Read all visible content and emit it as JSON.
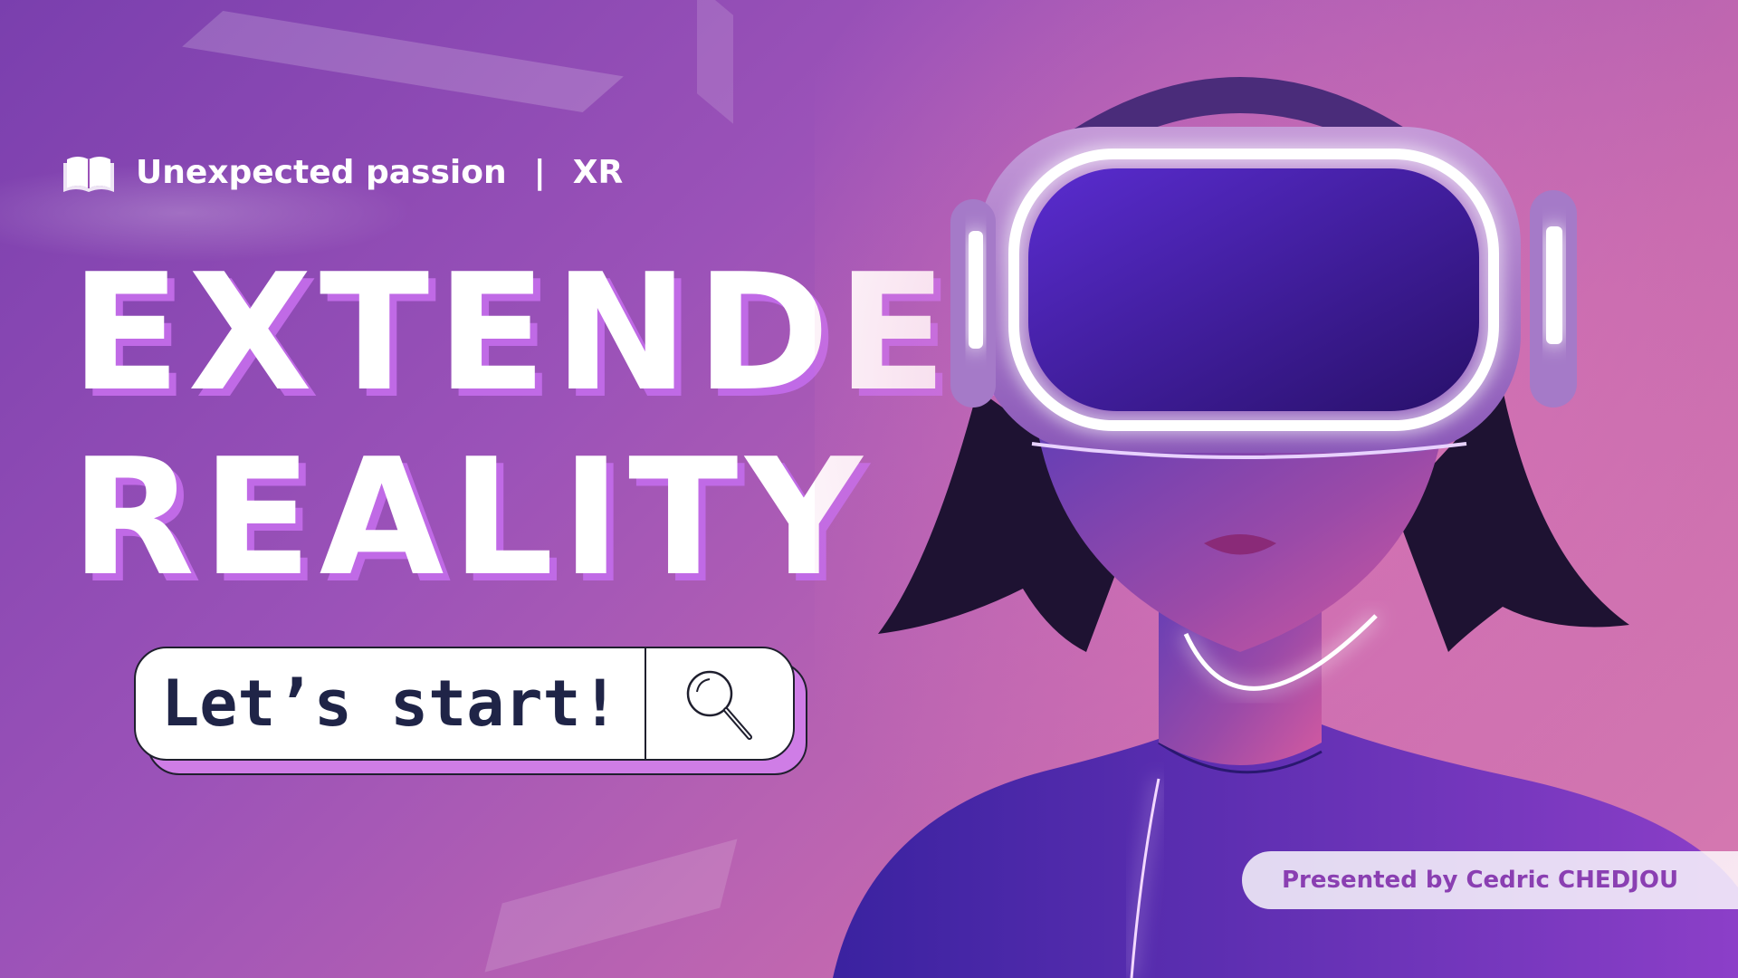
{
  "top_label": {
    "prefix": "Unexpected passion",
    "separator": "|",
    "suffix": "XR"
  },
  "headline": {
    "line1": "EXTENDED",
    "line2": "REALITY"
  },
  "cta": {
    "label": "Let’s start!"
  },
  "presenter": {
    "text": "Presented by Cedric CHEDJOU"
  },
  "colors": {
    "accent": "#c06ae6",
    "headline_text": "#ffffff",
    "cta_text": "#1f2447",
    "presenter_text": "#8a3fb2"
  },
  "icons": {
    "brand": "open-book-icon",
    "cta": "search-icon"
  }
}
